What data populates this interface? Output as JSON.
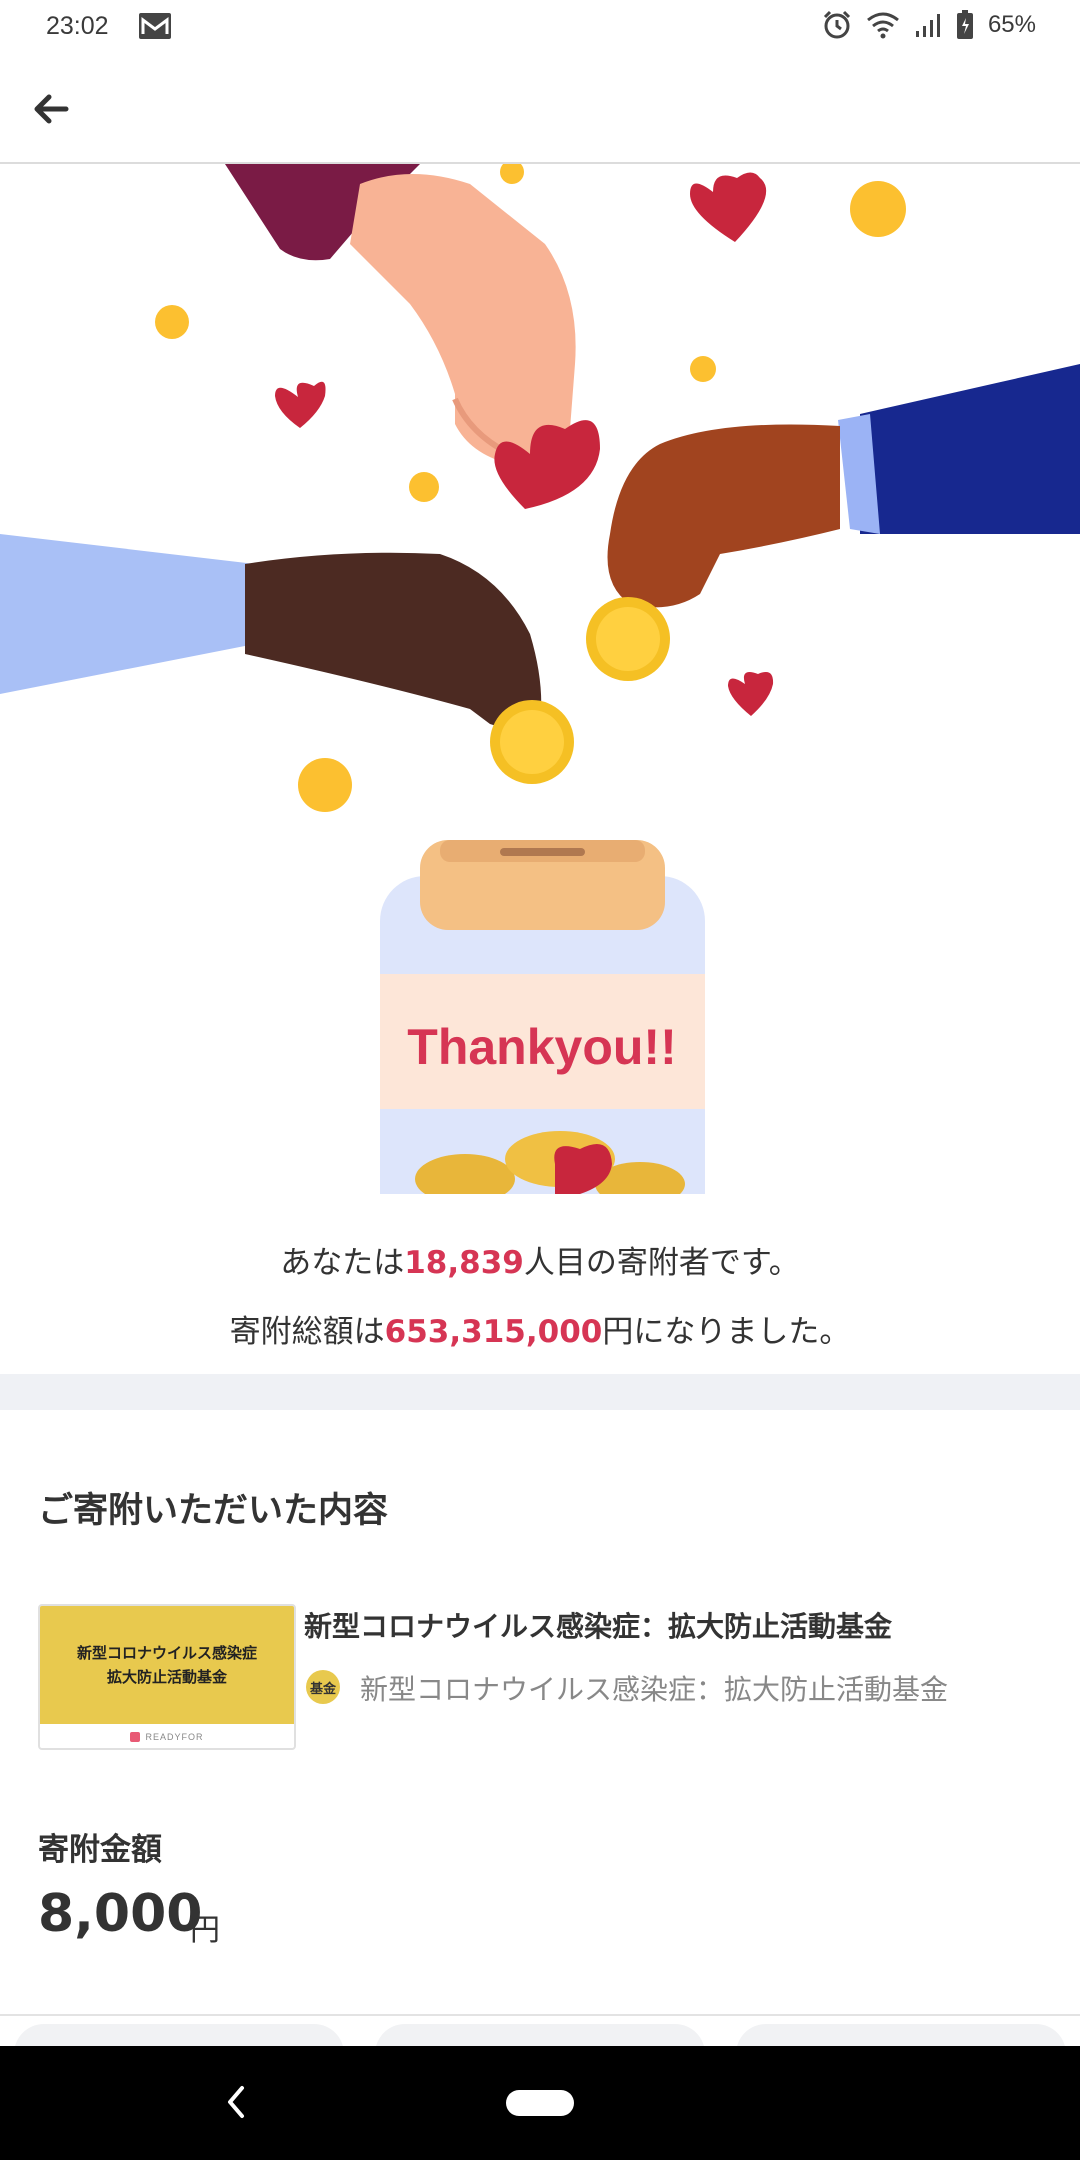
{
  "status_bar": {
    "time": "23:02",
    "battery": "65%",
    "icons": [
      "mail-icon",
      "alarm-icon",
      "wifi-icon",
      "signal-icon",
      "battery-icon"
    ]
  },
  "app_bar": {
    "back_icon": "arrow-left-icon"
  },
  "illustration": {
    "jar_text": "Thankyou!!"
  },
  "summary": {
    "line1_prefix": "あなたは",
    "donor_number": "18,839",
    "line1_suffix": "人目の寄附者です。",
    "line2_prefix": "寄附総額は",
    "total_amount": "653,315,000",
    "line2_suffix": "円になりました。"
  },
  "details": {
    "section_title": "ご寄附いただいた内容",
    "project": {
      "thumb_line1": "新型コロナウイルス感染症",
      "thumb_line2": "拡大防止活動基金",
      "thumb_logo": "READYFOR",
      "title": "新型コロナウイルス感染症：拡大防止活動基金",
      "badge": "基金",
      "org_name": "新型コロナウイルス感染症：拡大防止活動基金"
    },
    "amount_label": "寄附金額",
    "amount_value": "8,000",
    "amount_unit": "円"
  },
  "colors": {
    "accent": "#d63554",
    "badge": "#e8c94e",
    "separator": "#eff1f5"
  }
}
